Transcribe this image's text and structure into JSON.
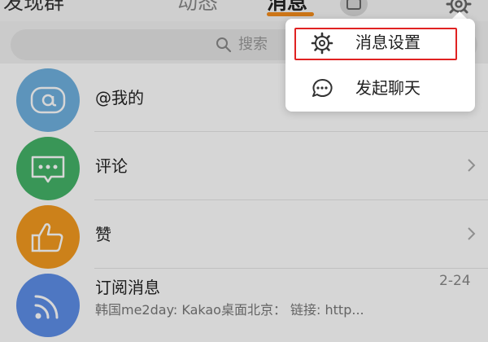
{
  "top_bar": {
    "tabs": [
      {
        "label": "发现群"
      },
      {
        "label": "动态"
      },
      {
        "label": "消息"
      }
    ],
    "accent_color": "#f38b1b"
  },
  "search": {
    "placeholder": "搜索"
  },
  "rows": [
    {
      "label": "@我的",
      "icon": "at-icon",
      "color": "#6fb0df"
    },
    {
      "label": "评论",
      "icon": "comment-icon",
      "color": "#44b368"
    },
    {
      "label": "赞",
      "icon": "thumbs-up-icon",
      "color": "#f39a1f"
    },
    {
      "label": "订阅消息",
      "time": "2-24",
      "preview": "韩国me2day: Kakao桌面北京： 链接: http...",
      "icon": "rss-icon",
      "color": "#5d8ee7"
    }
  ],
  "menu": {
    "items": [
      {
        "label": "消息设置",
        "icon": "gear-icon"
      },
      {
        "label": "发起聊天",
        "icon": "chat-bubble-icon"
      }
    ],
    "highlight_color": "#e02222"
  }
}
